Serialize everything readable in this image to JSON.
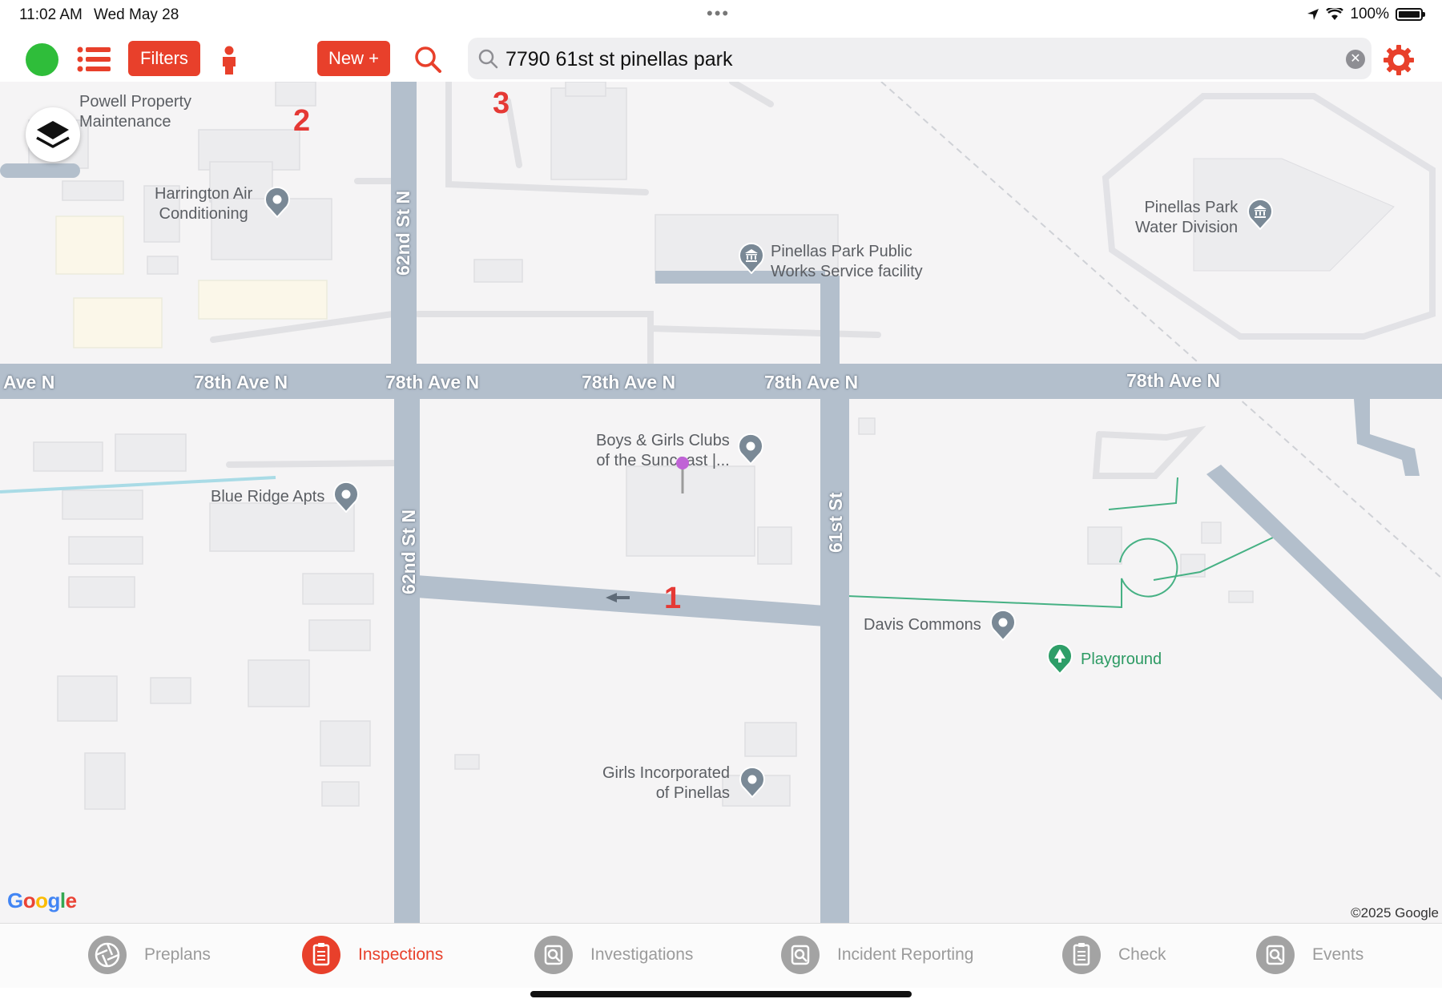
{
  "status_bar": {
    "time": "11:02 AM",
    "date": "Wed May 28",
    "battery": "100%"
  },
  "toolbar": {
    "filters_label": "Filters",
    "new_label": "New +",
    "search_value": "7790 61st st pinellas park",
    "colors": {
      "accent": "#e8402b",
      "status_green": "#2fbd3a"
    }
  },
  "map": {
    "places": [
      {
        "name": "Powell Property\nMaintenance",
        "icon": "none"
      },
      {
        "name": "Harrington Air\nConditioning",
        "icon": "pin-icon"
      },
      {
        "name": "Pinellas Park Public\nWorks Service facility",
        "icon": "government-icon"
      },
      {
        "name": "Pinellas Park\nWater Division",
        "icon": "government-icon"
      },
      {
        "name": "Boys & Girls Clubs\nof the Suncoast |...",
        "icon": "pin-icon"
      },
      {
        "name": "Blue Ridge Apts",
        "icon": "pin-icon"
      },
      {
        "name": "Davis Commons",
        "icon": "pin-icon"
      },
      {
        "name": "Playground",
        "icon": "tree-icon"
      },
      {
        "name": "Girls Incorporated\nof Pinellas",
        "icon": "pin-icon"
      }
    ],
    "roads": {
      "ave_partial": "Ave N",
      "ave": "78th Ave N",
      "street_62nd": "62nd St N",
      "street_61st": "61st St"
    },
    "markers": [
      "1",
      "2",
      "3"
    ],
    "google": "Google",
    "copyright": "©2025 Google"
  },
  "tabs": [
    {
      "label": "Preplans",
      "icon": "aperture-icon",
      "active": false
    },
    {
      "label": "Inspections",
      "icon": "clipboard-icon",
      "active": true
    },
    {
      "label": "Investigations",
      "icon": "magnifier-icon",
      "active": false
    },
    {
      "label": "Incident Reporting",
      "icon": "magnifier-icon",
      "active": false
    },
    {
      "label": "Check",
      "icon": "clipboard-icon",
      "active": false
    },
    {
      "label": "Events",
      "icon": "magnifier-icon",
      "active": false
    }
  ]
}
